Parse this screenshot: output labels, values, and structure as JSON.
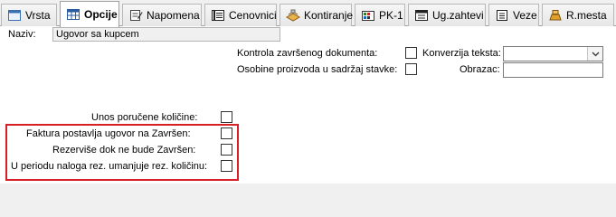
{
  "tabs": [
    {
      "id": "vrsta",
      "label": "Vrsta",
      "icon": "form-icon"
    },
    {
      "id": "opcije",
      "label": "Opcije",
      "icon": "grid-icon",
      "active": true
    },
    {
      "id": "napomena",
      "label": "Napomena",
      "icon": "note-icon"
    },
    {
      "id": "cenovnici",
      "label": "Cenovnici",
      "icon": "pricelist-icon"
    },
    {
      "id": "kontiranje",
      "label": "Kontiranje",
      "icon": "ledger-icon"
    },
    {
      "id": "pk1",
      "label": "PK-1",
      "icon": "pk-icon"
    },
    {
      "id": "ugzahtevi",
      "label": "Ug.zahtevi",
      "icon": "requests-icon"
    },
    {
      "id": "veze",
      "label": "Veze",
      "icon": "links-icon"
    },
    {
      "id": "rmesta",
      "label": "R.mesta",
      "icon": "workplace-icon"
    }
  ],
  "form": {
    "naziv_label": "Naziv:",
    "naziv_value": "Ugovor sa kupcem",
    "kontrola_label": "Kontrola završenog dokumenta:",
    "kontrola_checked": false,
    "osobine_label": "Osobine proizvoda u sadržaj stavke:",
    "osobine_checked": false,
    "konverzija_label": "Konverzija teksta:",
    "konverzija_value": "",
    "obrazac_label": "Obrazac:",
    "obrazac_value": "",
    "unos_label": "Unos poručene količine:",
    "unos_checked": false,
    "faktura_label": "Faktura postavlja ugovor na Završen:",
    "faktura_checked": false,
    "rezervise_label": "Rezerviše dok ne bude Završen:",
    "rezervise_checked": false,
    "periodu_label": "U periodu naloga rez. umanjuje rez. količinu:",
    "periodu_checked": false
  },
  "colors": {
    "highlight_border": "#d61f26",
    "panel_background": "#ffffff",
    "strip_background": "#f0f0f0"
  }
}
